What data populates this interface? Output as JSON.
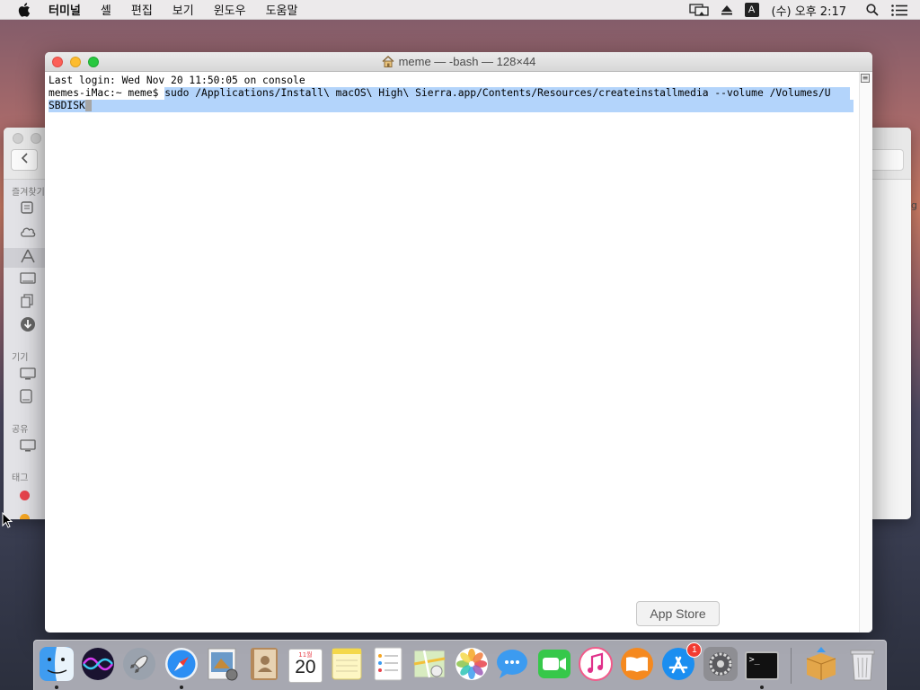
{
  "menubar": {
    "app_name": "터미널",
    "items": [
      "셸",
      "편집",
      "보기",
      "윈도우",
      "도움말"
    ],
    "ime_label": "A",
    "clock": "(수) 오후 2:17"
  },
  "terminal": {
    "title": "meme — -bash — 128×44",
    "line1": "Last login: Wed Nov 20 11:50:05 on console",
    "prompt": "memes-iMac:~ meme$ ",
    "command_part1": "sudo /Applications/Install\\ macOS\\ High\\ Sierra.app/Contents/Resources/createinstallmedia --volume /Volumes/U",
    "command_part2": "SBDISK"
  },
  "finder": {
    "section_favorites": "즐겨찾기",
    "section_devices": "기기",
    "section_shared": "공유",
    "section_tags": "태그",
    "tag_colors": [
      "#e8434c",
      "#f5a623"
    ]
  },
  "tooltip": {
    "label": "App Store"
  },
  "dock": {
    "calendar_month": "11월",
    "calendar_day": "20",
    "appstore_badge": "1",
    "terminal_glyph": ">_"
  },
  "side_text": "g"
}
